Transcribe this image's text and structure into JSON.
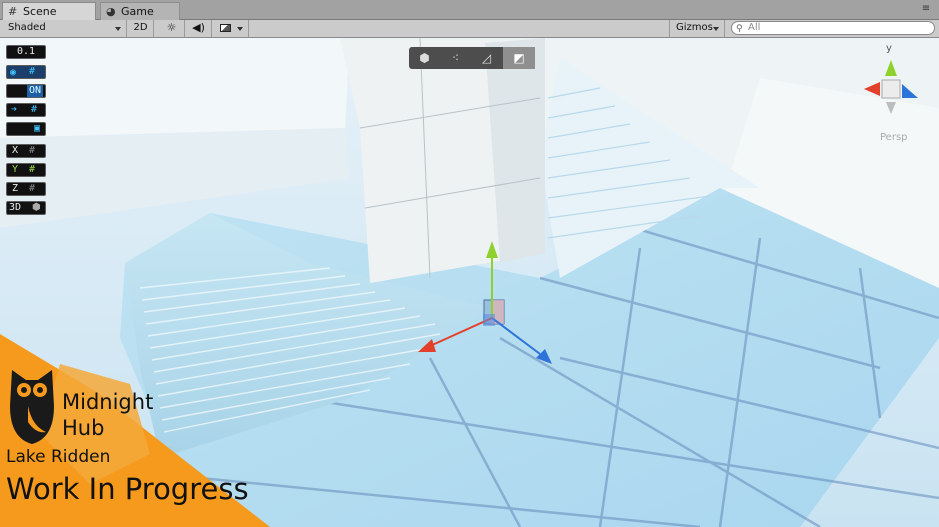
{
  "tabs": {
    "scene": {
      "icon": "grid-icon",
      "label": "Scene"
    },
    "game": {
      "icon": "pacman-icon",
      "label": "Game"
    }
  },
  "toolbar": {
    "draw_mode": "Shaded",
    "mode_2d": "2D",
    "gizmos": "Gizmos",
    "search_placeholder": "All"
  },
  "snap_panel": {
    "value": "0.1",
    "toggle_on": "ON",
    "axes": [
      "X",
      "Y",
      "Z"
    ],
    "mode_3d": "3D"
  },
  "tool_buttons": [
    "shape-icon",
    "vertex-icon",
    "edge-icon",
    "face-icon"
  ],
  "orientation": {
    "label": "Persp",
    "y": "y"
  },
  "colors": {
    "x_axis": "#e2402a",
    "y_axis": "#8ed12c",
    "z_axis": "#2d73d9",
    "banner": "#f59a1c"
  },
  "banner": {
    "brand_line1": "Midnight",
    "brand_line2": "Hub",
    "project": "Lake Ridden",
    "status": "Work In Progress"
  }
}
